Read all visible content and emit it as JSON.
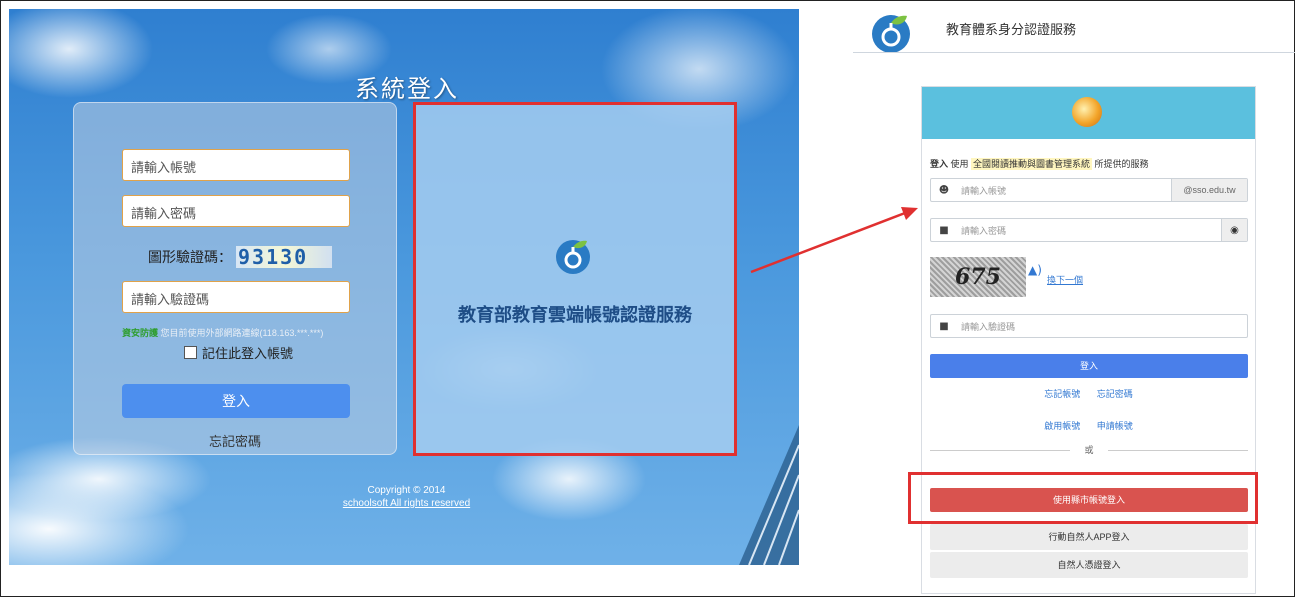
{
  "left": {
    "title": "系統登入",
    "account_placeholder": "請輸入帳號",
    "password_placeholder": "請輸入密碼",
    "captcha_label": "圖形驗證碼：",
    "captcha_value": "93130",
    "code_placeholder": "請輸入驗證碼",
    "security_tag": "資安防護",
    "security_text": " 您目前使用外部網路連線(118.163.***.***)",
    "remember_label": "記住此登入帳號",
    "login_button": "登入",
    "forgot_password": "忘記密碼",
    "highlight_title": "教育部教育雲端帳號認證服務",
    "copyright_line1": "Copyright © 2014",
    "copyright_line2": "schoolsoft All rights reserved"
  },
  "right": {
    "header_title": "教育體系身分認證服務",
    "intro_bold": "登入",
    "intro_use": " 使用 ",
    "intro_system": "全國閱讀推動與圖書管理系統",
    "intro_tail": " 所提供的服務",
    "account_placeholder": "請輸入帳號",
    "account_suffix": "@sso.edu.tw",
    "password_placeholder": "請輸入密碼",
    "captcha_value": "675",
    "next_captcha": "換下一個",
    "code_placeholder": "請輸入驗證碼",
    "login_button": "登入",
    "forgot_account": "忘記帳號",
    "forgot_password": "忘記密碼",
    "activate_account": "啟用帳號",
    "apply_account": "申請帳號",
    "or_label": "或",
    "county_login": "使用縣市帳號登入",
    "app_login": "行動自然人APP登入",
    "cert_login": "自然人憑證登入"
  },
  "colors": {
    "highlight_red": "#e03030",
    "sso_header": "#5bc0de",
    "sso_primary": "#4a7fea",
    "sso_danger": "#d9534f"
  },
  "icons": [
    "user-icon",
    "lock-icon",
    "eye-icon",
    "speaker-icon",
    "globe-icon",
    "edu-cloud-logo-icon"
  ]
}
